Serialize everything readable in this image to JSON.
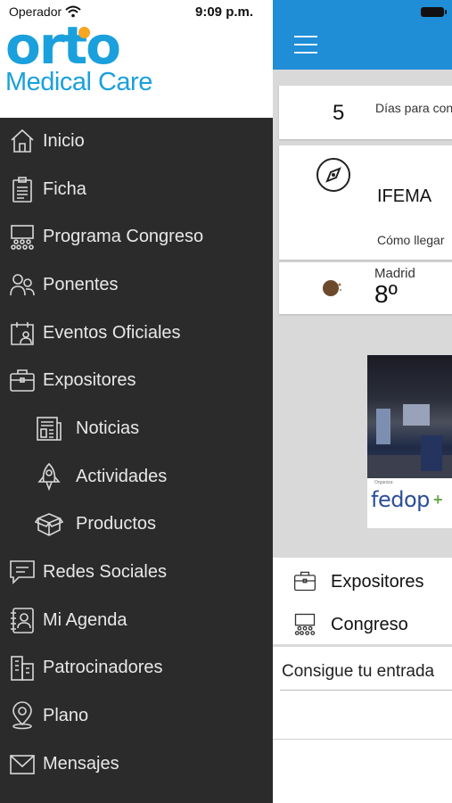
{
  "status_bar": {
    "carrier": "Operador",
    "time": "9:09 p.m."
  },
  "logo": {
    "main": "orto",
    "sub": "Medical Care",
    "color": "#1aa0dc",
    "dot_color": "#f5a623"
  },
  "menu": [
    {
      "label": "Inicio",
      "icon": "home-icon"
    },
    {
      "label": "Ficha",
      "icon": "clipboard-icon"
    },
    {
      "label": "Programa Congreso",
      "icon": "audience-icon"
    },
    {
      "label": "Ponentes",
      "icon": "people-icon"
    },
    {
      "label": "Eventos Oficiales",
      "icon": "calendar-person-icon"
    },
    {
      "label": "Expositores",
      "icon": "briefcase-icon"
    },
    {
      "label": "Noticias",
      "icon": "newspaper-icon"
    },
    {
      "label": "Actividades",
      "icon": "rocket-icon"
    },
    {
      "label": "Productos",
      "icon": "box-icon"
    },
    {
      "label": "Redes Sociales",
      "icon": "chat-icon"
    },
    {
      "label": "Mi Agenda",
      "icon": "agenda-icon"
    },
    {
      "label": "Patrocinadores",
      "icon": "buildings-icon"
    },
    {
      "label": "Plano",
      "icon": "map-pin-icon"
    },
    {
      "label": "Mensajes",
      "icon": "envelope-icon"
    }
  ],
  "home": {
    "days_number": "5",
    "days_text": "Días para con",
    "venue": "IFEMA",
    "venue_link": "Cómo llegar",
    "weather_city": "Madrid",
    "weather_temp": "8º",
    "banner_small": "Organiza:",
    "banner_brand": "fedop",
    "quick_links": [
      {
        "label": "Expositores",
        "icon": "briefcase-icon"
      },
      {
        "label": "Congreso",
        "icon": "audience-icon"
      }
    ],
    "ticket_label": "Consigue tu entrada"
  },
  "colors": {
    "drawer_bg": "#2b2b2b",
    "topbar_bg": "#1f8ed6",
    "content_bg": "#d9d9d9"
  }
}
